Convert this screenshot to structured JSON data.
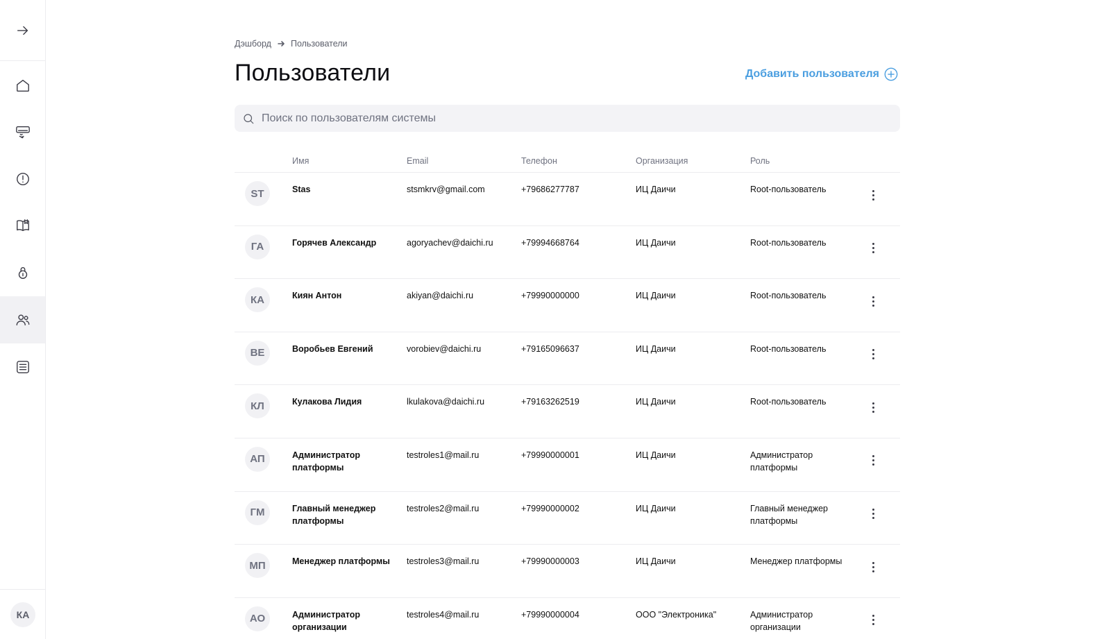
{
  "sidebar": {
    "expand_icon": "arrow-right-icon",
    "items": [
      {
        "icon": "home-icon",
        "active": false
      },
      {
        "icon": "air-conditioner-icon",
        "active": false
      },
      {
        "icon": "alert-icon",
        "active": false
      },
      {
        "icon": "book-icon",
        "active": false
      },
      {
        "icon": "lock-icon",
        "active": false
      },
      {
        "icon": "users-icon",
        "active": true
      },
      {
        "icon": "list-icon",
        "active": false
      }
    ],
    "user_initials": "КА"
  },
  "breadcrumb": {
    "items": [
      "Дэшборд",
      "Пользователи"
    ]
  },
  "page": {
    "title": "Пользователи",
    "add_user_label": "Добавить пользователя"
  },
  "search": {
    "placeholder": "Поиск по пользователям системы",
    "value": ""
  },
  "table": {
    "columns": {
      "name": "Имя",
      "email": "Email",
      "phone": "Телефон",
      "org": "Организация",
      "role": "Роль"
    },
    "rows": [
      {
        "initials": "ST",
        "name": "Stas",
        "email": "stsmkrv@gmail.com",
        "phone": "+79686277787",
        "org": "ИЦ Даичи",
        "role": "Root-пользователь"
      },
      {
        "initials": "ГА",
        "name": "Горячев Александр",
        "email": "agoryachev@daichi.ru",
        "phone": "+79994668764",
        "org": "ИЦ Даичи",
        "role": "Root-пользователь"
      },
      {
        "initials": "КА",
        "name": "Киян Антон",
        "email": "akiyan@daichi.ru",
        "phone": "+79990000000",
        "org": "ИЦ Даичи",
        "role": "Root-пользователь"
      },
      {
        "initials": "ВЕ",
        "name": "Воробьев Евгений",
        "email": "vorobiev@daichi.ru",
        "phone": "+79165096637",
        "org": "ИЦ Даичи",
        "role": "Root-пользователь"
      },
      {
        "initials": "КЛ",
        "name": "Кулакова Лидия",
        "email": "lkulakova@daichi.ru",
        "phone": "+79163262519",
        "org": "ИЦ Даичи",
        "role": "Root-пользователь"
      },
      {
        "initials": "АП",
        "name": "Администратор платформы",
        "email": "testroles1@mail.ru",
        "phone": "+79990000001",
        "org": "ИЦ Даичи",
        "role": "Администратор платформы"
      },
      {
        "initials": "ГМ",
        "name": "Главный менеджер платформы",
        "email": "testroles2@mail.ru",
        "phone": "+79990000002",
        "org": "ИЦ Даичи",
        "role": "Главный менеджер платформы"
      },
      {
        "initials": "МП",
        "name": "Менеджер платформы",
        "email": "testroles3@mail.ru",
        "phone": "+79990000003",
        "org": "ИЦ Даичи",
        "role": "Менеджер платформы"
      },
      {
        "initials": "АО",
        "name": "Администратор организации",
        "email": "testroles4@mail.ru",
        "phone": "+79990000004",
        "org": "ООО \"Электроника\"",
        "role": "Администратор организации"
      }
    ]
  },
  "colors": {
    "accent": "#4a9ee0",
    "sidebar_active_bg": "#f1f1f4",
    "search_bg": "#f3f3f6"
  }
}
